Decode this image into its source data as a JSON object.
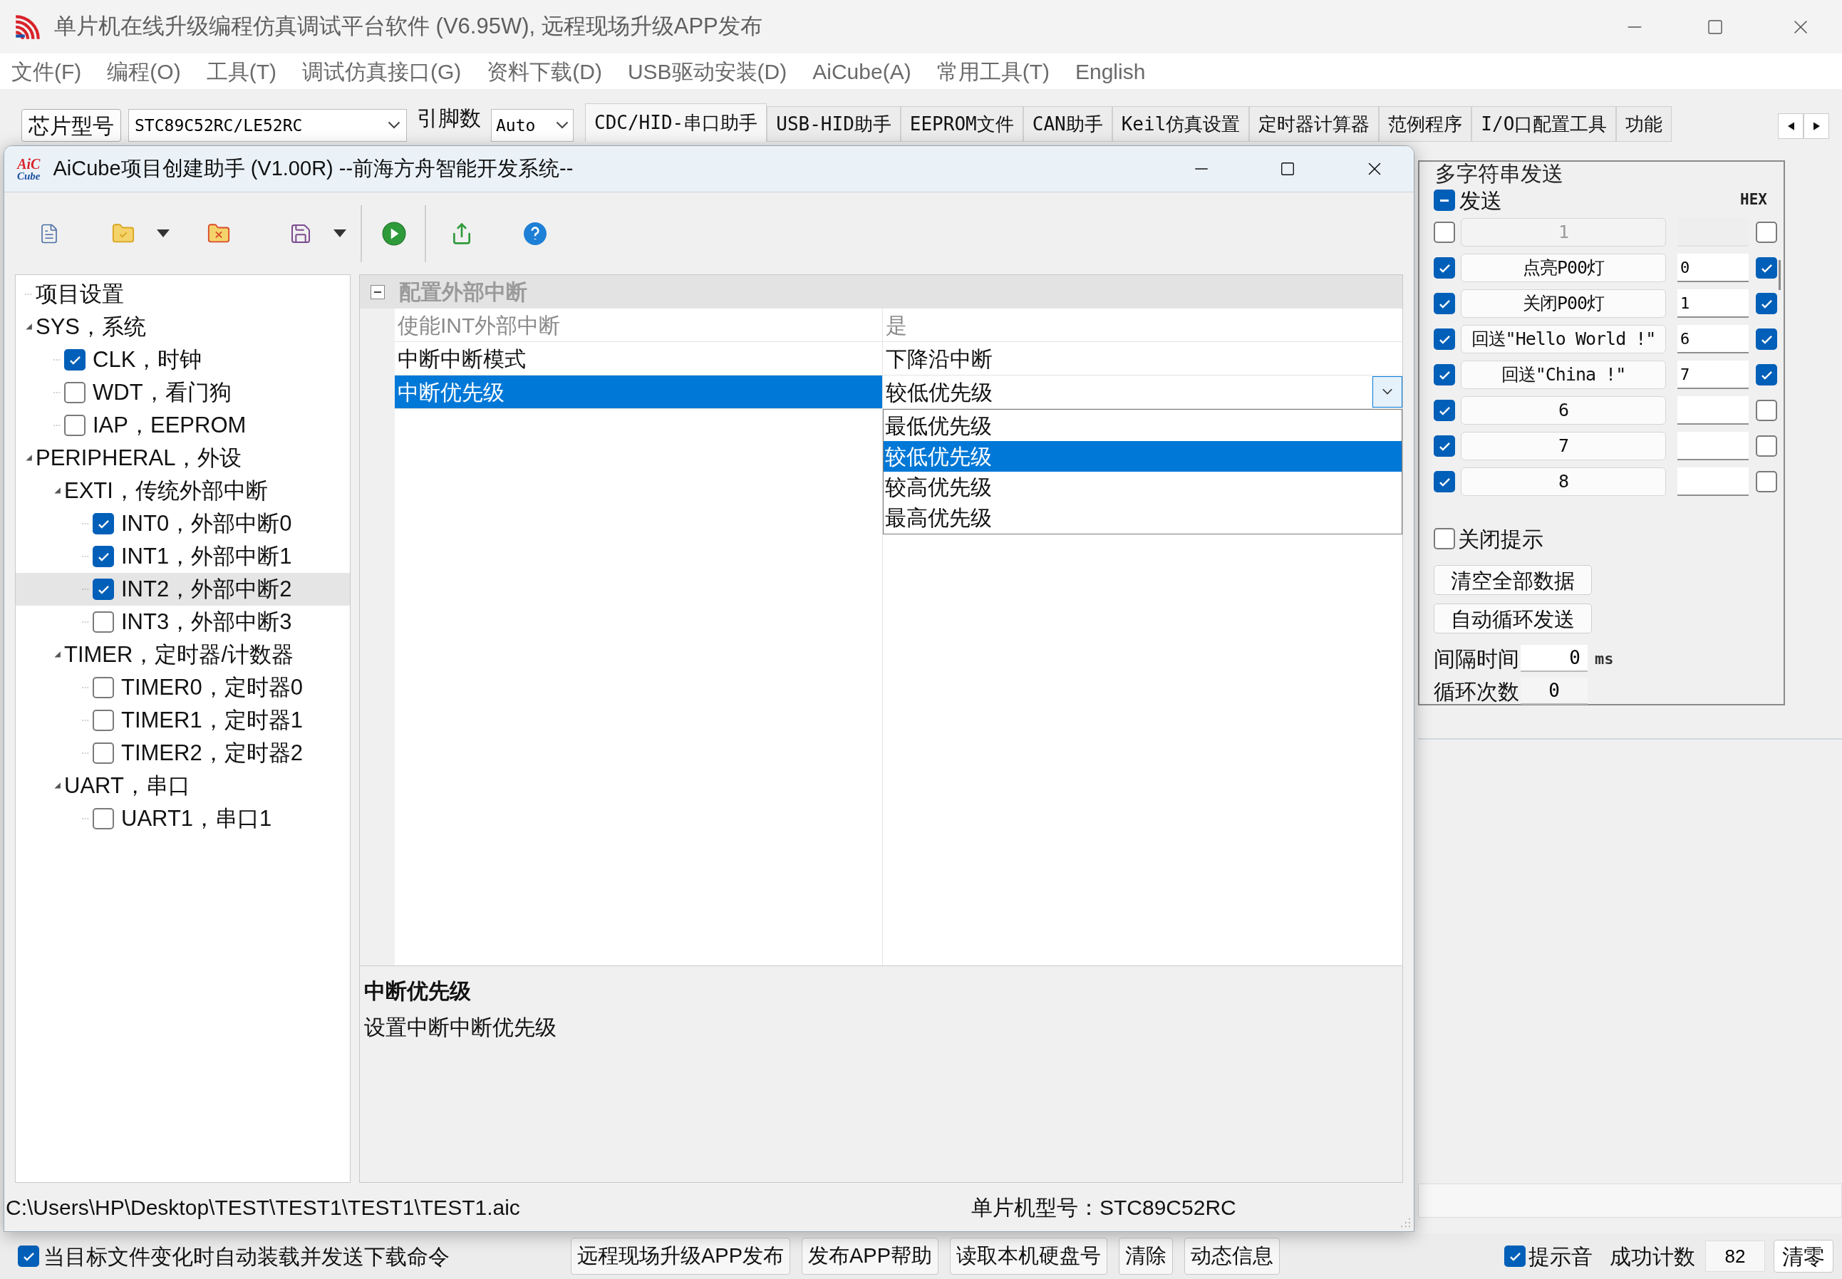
{
  "main_window": {
    "title": "单片机在线升级编程仿真调试平台软件 (V6.95W), 远程现场升级APP发布",
    "menu": [
      "文件(F)",
      "编程(O)",
      "工具(T)",
      "调试仿真接口(G)",
      "资料下载(D)",
      "USB驱动安装(D)",
      "AiCube(A)",
      "常用工具(T)",
      "English"
    ],
    "toolbar": {
      "chip_button": "芯片型号",
      "chip_select": "STC89C52RC/LE52RC",
      "pin_label": "引脚数",
      "pin_select": "Auto"
    },
    "tabs": [
      {
        "label": "CDC/HID-串口助手",
        "selected": true
      },
      {
        "label": "USB-HID助手",
        "selected": false
      },
      {
        "label": "EEPROM文件",
        "selected": false
      },
      {
        "label": "CAN助手",
        "selected": false
      },
      {
        "label": "Keil仿真设置",
        "selected": false
      },
      {
        "label": "定时器计算器",
        "selected": false
      },
      {
        "label": "范例程序",
        "selected": false
      },
      {
        "label": "I/O口配置工具",
        "selected": false
      },
      {
        "label": "功能",
        "selected": false
      }
    ]
  },
  "project_window": {
    "title": "AiCube项目创建助手 (V1.00R) --前海方舟智能开发系统--",
    "logo": [
      "AiC",
      "Cube"
    ],
    "tree": [
      {
        "label": "项目设置",
        "kind": "label",
        "selected": false
      },
      {
        "label": "SYS，系统",
        "kind": "group",
        "expanded": true,
        "selected": false,
        "children": [
          {
            "label": "CLK，时钟",
            "kind": "check",
            "checked": true,
            "selected": false
          },
          {
            "label": "WDT，看门狗",
            "kind": "check",
            "checked": false,
            "selected": false
          },
          {
            "label": "IAP，EEPROM",
            "kind": "check",
            "checked": false,
            "selected": false
          }
        ]
      },
      {
        "label": "PERIPHERAL，外设",
        "kind": "group",
        "expanded": true,
        "selected": false,
        "children": [
          {
            "label": "EXTI，传统外部中断",
            "kind": "group",
            "expanded": true,
            "selected": false,
            "children": [
              {
                "label": "INT0，外部中断0",
                "kind": "check",
                "checked": true,
                "selected": false
              },
              {
                "label": "INT1，外部中断1",
                "kind": "check",
                "checked": true,
                "selected": false
              },
              {
                "label": "INT2，外部中断2",
                "kind": "check",
                "checked": true,
                "selected": true
              },
              {
                "label": "INT3，外部中断3",
                "kind": "check",
                "checked": false,
                "selected": false
              }
            ]
          },
          {
            "label": "TIMER，定时器/计数器",
            "kind": "group",
            "expanded": true,
            "selected": false,
            "children": [
              {
                "label": "TIMER0，定时器0",
                "kind": "check",
                "checked": false,
                "selected": false
              },
              {
                "label": "TIMER1，定时器1",
                "kind": "check",
                "checked": false,
                "selected": false
              },
              {
                "label": "TIMER2，定时器2",
                "kind": "check",
                "checked": false,
                "selected": false
              }
            ]
          },
          {
            "label": "UART，串口",
            "kind": "group",
            "expanded": true,
            "selected": false,
            "children": [
              {
                "label": "UART1，串口1",
                "kind": "check",
                "checked": false,
                "selected": false
              }
            ]
          }
        ]
      }
    ],
    "property_grid": {
      "section": "配置外部中断",
      "expanded": true,
      "rows": [
        {
          "name": "使能INT外部中断",
          "value": "是",
          "disabled": true,
          "selected": false
        },
        {
          "name": "中断中断模式",
          "value": "下降沿中断",
          "disabled": false,
          "selected": false
        },
        {
          "name": "中断优先级",
          "value": "较低优先级",
          "disabled": false,
          "selected": true
        }
      ],
      "dropdown": [
        {
          "label": "最低优先级",
          "selected": false
        },
        {
          "label": "较低优先级",
          "selected": true
        },
        {
          "label": "较高优先级",
          "selected": false
        },
        {
          "label": "最高优先级",
          "selected": false
        }
      ]
    },
    "description": {
      "title": "中断优先级",
      "text": "设置中断中断优先级"
    },
    "status": {
      "path": "C:\\Users\\HP\\Desktop\\TEST\\TEST1\\TEST1\\TEST1.aic",
      "chip": "单片机型号：STC89C52RC"
    }
  },
  "multi_send": {
    "title": "多字符串发送",
    "send_all": {
      "label": "发送",
      "indeterminate": true
    },
    "hex_header": "HEX",
    "rows": [
      {
        "send": false,
        "label": "1",
        "value": "",
        "hex": false,
        "disabled": true
      },
      {
        "send": true,
        "label": "点亮P00灯",
        "value": "0",
        "hex": true,
        "disabled": false
      },
      {
        "send": true,
        "label": "关闭P00灯",
        "value": "1",
        "hex": true,
        "disabled": false
      },
      {
        "send": true,
        "label": "回送\"Hello World !\"",
        "value": "6",
        "hex": true,
        "disabled": false
      },
      {
        "send": true,
        "label": "回送\"China !\"",
        "value": "7",
        "hex": true,
        "disabled": false
      },
      {
        "send": true,
        "label": "6",
        "value": "",
        "hex": false,
        "disabled": false
      },
      {
        "send": true,
        "label": "7",
        "value": "",
        "hex": false,
        "disabled": false
      },
      {
        "send": true,
        "label": "8",
        "value": "",
        "hex": false,
        "disabled": false
      }
    ],
    "close_tips": {
      "label": "关闭提示",
      "checked": false
    },
    "buttons": [
      "清空全部数据",
      "自动循环发送"
    ],
    "interval": {
      "label": "间隔时间",
      "value": "0",
      "unit": "ms"
    },
    "loop": {
      "label": "循环次数",
      "value": "0"
    }
  },
  "bottom_bar": {
    "auto_load": {
      "label": "当目标文件变化时自动装载并发送下载命令",
      "checked": true
    },
    "buttons": [
      "远程现场升级APP发布",
      "发布APP帮助",
      "读取本机硬盘号",
      "清除",
      "动态信息"
    ],
    "beep": {
      "label": "提示音",
      "checked": true
    },
    "count_label": "成功计数",
    "count": "82",
    "reset": "清零"
  }
}
